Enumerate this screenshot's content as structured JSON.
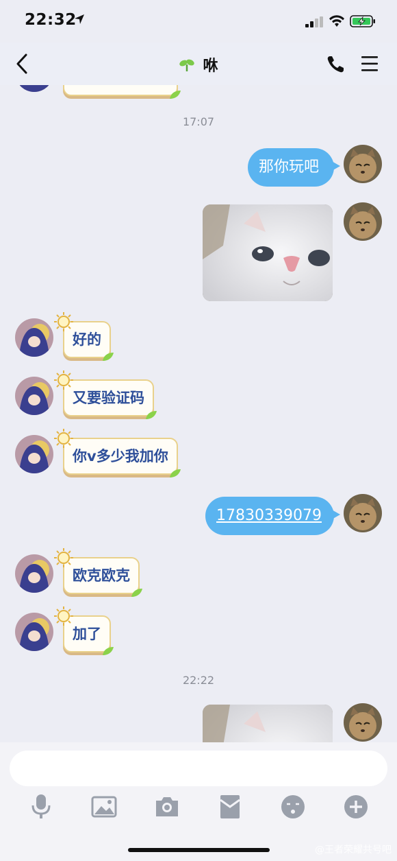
{
  "status_bar": {
    "time": "22:32"
  },
  "nav": {
    "title": "咻"
  },
  "messages": {
    "ts1": "17:07",
    "m1": "那你玩吧",
    "m3": "好的",
    "m4": "又要验证码",
    "m5": "你v多少我加你",
    "m6": "17830339079",
    "m7": "欧克欧克",
    "m8": "加了",
    "ts2": "22:22"
  },
  "input": {
    "value": "",
    "placeholder": ""
  },
  "watermark": "@王者荣耀共号吧",
  "colors": {
    "outgoing_bubble": "#5ab4f0",
    "incoming_text": "#2e4f9a",
    "incoming_border": "#e9d18b",
    "background": "#ecedf4"
  },
  "icons": [
    "location-arrow-icon",
    "signal-icon",
    "wifi-icon",
    "battery-charging-icon",
    "back-chevron-icon",
    "sprout-icon",
    "phone-icon",
    "menu-icon",
    "microphone-icon",
    "image-icon",
    "camera-icon",
    "red-packet-icon",
    "emoji-icon",
    "plus-icon"
  ]
}
